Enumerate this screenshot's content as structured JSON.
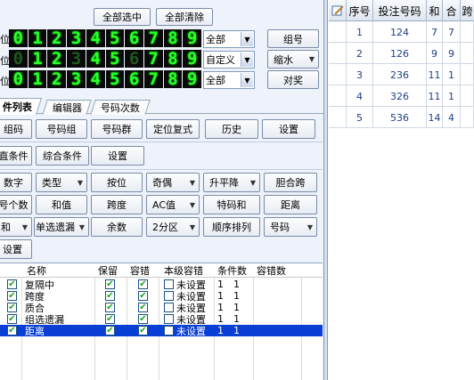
{
  "top_buttons": {
    "select_all": "全部选中",
    "clear_all": "全部清除"
  },
  "rows": [
    {
      "label": "位",
      "select": "全部",
      "button": "组号",
      "digits": [
        "0",
        "1",
        "2",
        "3",
        "4",
        "5",
        "6",
        "7",
        "8",
        "9"
      ],
      "dim": []
    },
    {
      "label": "位",
      "select": "自定义",
      "button": "缩水",
      "digits": [
        "0",
        "1",
        "2",
        "3",
        "4",
        "5",
        "6",
        "7",
        "8",
        "9"
      ],
      "dim": [
        0,
        3,
        6
      ]
    },
    {
      "label": "位",
      "select": "全部",
      "button": "对奖",
      "digits": [
        "0",
        "1",
        "2",
        "3",
        "4",
        "5",
        "6",
        "7",
        "8",
        "9"
      ],
      "dim": []
    }
  ],
  "tabs": [
    "件列表",
    "编辑器",
    "号码次数"
  ],
  "toolbar_rows": [
    [
      "组码",
      "号码组",
      "号码群",
      "定位复式",
      "历史",
      "设置"
    ],
    [
      "直条件",
      "综合条件",
      "设置"
    ],
    [
      "数字",
      "类型",
      "按位",
      "奇偶",
      "升平降",
      "胆合跨"
    ],
    [
      "号个数",
      "和值",
      "跨度",
      "AC值",
      "特码和",
      "距离"
    ],
    [
      "和",
      "单选遗漏",
      "余数",
      "2分区",
      "顺序排列",
      "号码"
    ],
    [
      "设置"
    ]
  ],
  "grid": {
    "headers": [
      "名称",
      "保留",
      "容错",
      "本级容错",
      "条件数",
      "容错数"
    ],
    "rows": [
      {
        "name": "复隔中",
        "keep": "✔",
        "tolerate": "✔",
        "level": "未设置",
        "count": "1",
        "err": "1"
      },
      {
        "name": "跨度",
        "keep": "✔",
        "tolerate": "✔",
        "level": "未设置",
        "count": "1",
        "err": "1"
      },
      {
        "name": "质合",
        "keep": "✔",
        "tolerate": "✔",
        "level": "未设置",
        "count": "1",
        "err": "1"
      },
      {
        "name": "组选遗漏",
        "keep": "✔",
        "tolerate": "✔",
        "level": "未设置",
        "count": "1",
        "err": "1"
      },
      {
        "name": "距离",
        "keep": "✔",
        "tolerate": "✔",
        "level": "未设置",
        "count": "1",
        "err": "1"
      }
    ]
  },
  "result_table": {
    "headers": [
      "序号",
      "投注号码",
      "和",
      "合",
      "跨"
    ],
    "rows": [
      [
        "1",
        "124",
        "7",
        "7",
        ""
      ],
      [
        "2",
        "126",
        "9",
        "9",
        ""
      ],
      [
        "3",
        "236",
        "11",
        "1",
        ""
      ],
      [
        "4",
        "326",
        "11",
        "1",
        ""
      ],
      [
        "5",
        "536",
        "14",
        "4",
        ""
      ]
    ]
  }
}
